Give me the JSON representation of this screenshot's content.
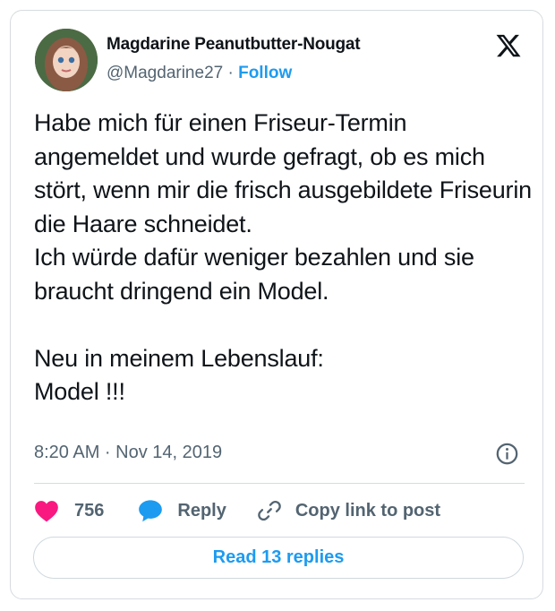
{
  "author": {
    "name": "Magdarine Peanutbutter-Nougat",
    "handle": "@Magdarine27",
    "separator": "·",
    "follow_label": "Follow"
  },
  "tweet": {
    "text": "Habe mich für einen Friseur-Termin angemeldet und wurde gefragt, ob es mich stört, wenn mir die frisch ausgebildete Friseurin die Haare schneidet.\nIch würde dafür weniger bezahlen und sie braucht dringend ein Model.\n\nNeu in meinem Lebenslauf:\nModel !!!",
    "timestamp": "8:20 AM · Nov 14, 2019"
  },
  "actions": {
    "like_count": "756",
    "reply_label": "Reply",
    "copy_label": "Copy link to post"
  },
  "read_replies_label": "Read 13 replies",
  "colors": {
    "accent": "#1d9bf0",
    "like": "#f91880",
    "muted": "#536471",
    "text": "#0f1419"
  },
  "icons": [
    "x-logo-icon",
    "info-icon",
    "heart-icon",
    "reply-bubble-icon",
    "link-icon"
  ]
}
